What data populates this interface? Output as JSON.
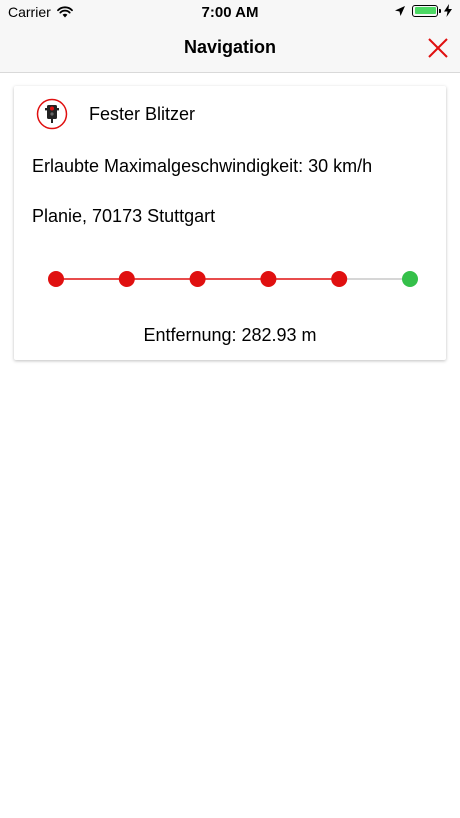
{
  "status_bar": {
    "carrier": "Carrier",
    "time": "7:00 AM"
  },
  "nav": {
    "title": "Navigation",
    "close_icon": "close-icon"
  },
  "card": {
    "icon": "traffic-light-icon",
    "title": "Fester Blitzer",
    "speed_limit": "Erlaubte Maximalgeschwindigkeit: 30 km/h",
    "address": "Planie, 70173 Stuttgart",
    "distance": "Entfernung: 282.93 m"
  },
  "progress": {
    "total_steps": 6,
    "completed_steps": 5,
    "active_color": "#e01010",
    "inactive_color": "#c8c8c8",
    "end_color": "#35c04a"
  },
  "colors": {
    "accent": "#e01010",
    "battery_fill": "#4cd964"
  }
}
